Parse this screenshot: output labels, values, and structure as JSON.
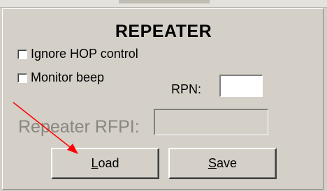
{
  "title": "REPEATER",
  "checkboxes": {
    "ignore_hop": {
      "label": "Ignore HOP control",
      "checked": false
    },
    "monitor_beep": {
      "label": "Monitor beep",
      "checked": false
    }
  },
  "rpn": {
    "label": "RPN:",
    "value": ""
  },
  "rfpi": {
    "label": "Repeater RFPI:",
    "value": ""
  },
  "buttons": {
    "load": {
      "accel": "L",
      "rest": "oad"
    },
    "save": {
      "accel": "S",
      "rest": "ave"
    }
  },
  "colors": {
    "annotation_arrow": "#ff0000",
    "panel_bg": "#d4d0c8"
  }
}
